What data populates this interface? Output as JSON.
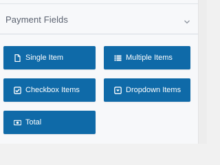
{
  "section": {
    "title": "Payment Fields",
    "collapse_icon": "chevron-down-icon"
  },
  "fields": [
    {
      "label": "Single Item",
      "icon": "file-icon"
    },
    {
      "label": "Multiple Items",
      "icon": "list-icon"
    },
    {
      "label": "Checkbox Items",
      "icon": "checkbox-icon"
    },
    {
      "label": "Dropdown Items",
      "icon": "dropdown-icon"
    },
    {
      "label": "Total",
      "icon": "money-icon"
    }
  ],
  "colors": {
    "button_bg": "#0f6aa8",
    "button_text": "#ffffff",
    "section_title": "#5b6270",
    "panel_bg": "#f7f8fa"
  }
}
